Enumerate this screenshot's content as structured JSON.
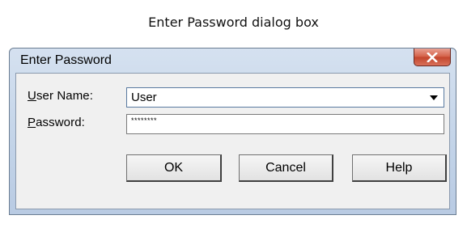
{
  "caption": "Enter Password dialog box",
  "window": {
    "title": "Enter Password",
    "close_icon": "close-icon"
  },
  "form": {
    "user_name": {
      "label_access": "U",
      "label_rest": "ser Name:",
      "value": "User",
      "dropdown_icon": "chevron-down-icon"
    },
    "password": {
      "label_access": "P",
      "label_rest": "assword:",
      "value": "********"
    }
  },
  "buttons": {
    "ok": "OK",
    "cancel": "Cancel",
    "help": "Help"
  }
}
